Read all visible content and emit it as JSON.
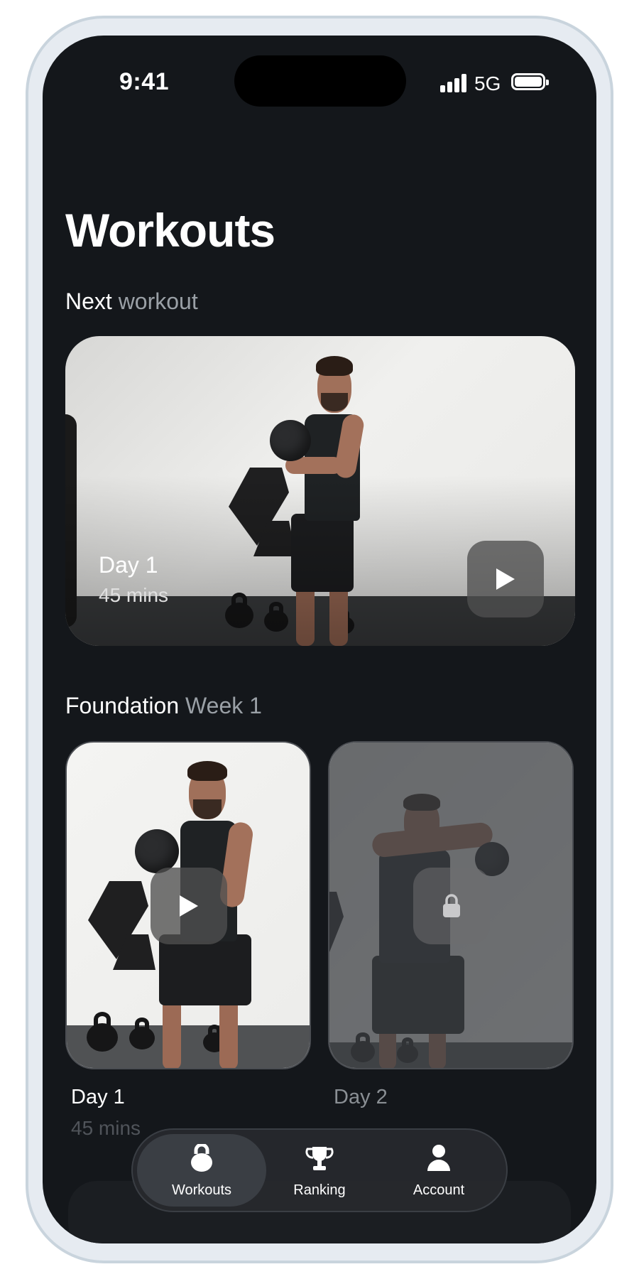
{
  "status_bar": {
    "time": "9:41",
    "network": "5G"
  },
  "page": {
    "title": "Workouts"
  },
  "next_workout": {
    "label_strong": "Next",
    "label_muted": "workout",
    "card": {
      "title": "Day 1",
      "duration": "45 mins"
    }
  },
  "program": {
    "label_strong": "Foundation",
    "label_muted": "Week 1",
    "days": [
      {
        "title": "Day 1",
        "duration": "45 mins",
        "locked": false
      },
      {
        "title": "Day 2",
        "locked": true
      }
    ]
  },
  "tab_bar": {
    "tabs": [
      {
        "label": "Workouts",
        "icon": "kettlebell-icon",
        "active": true
      },
      {
        "label": "Ranking",
        "icon": "trophy-icon",
        "active": false
      },
      {
        "label": "Account",
        "icon": "person-icon",
        "active": false
      }
    ]
  },
  "colors": {
    "background": "#14171b",
    "muted_text": "#9aa0a6",
    "tab_active": "#3a3e44"
  }
}
